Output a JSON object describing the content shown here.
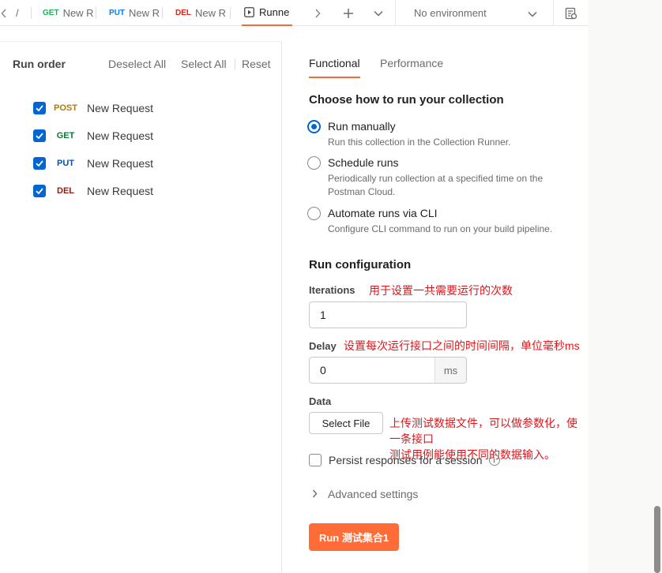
{
  "tabs": [
    {
      "method": "",
      "method_color": "#6b6b6b",
      "label": "/"
    },
    {
      "method": "GET",
      "method_color": "#0cbb52",
      "label": "New R"
    },
    {
      "method": "PUT",
      "method_color": "#097bed",
      "label": "New R"
    },
    {
      "method": "DEL",
      "method_color": "#eb2013",
      "label": "New R"
    },
    {
      "method": "",
      "method_color": "#212121",
      "label": "Runne"
    }
  ],
  "toolbar": {
    "back_icon": "chevron-left-icon",
    "forward_icon": "chevron-right-icon",
    "add_icon": "plus-icon",
    "menu_icon": "chevron-down-icon",
    "env_label": "No environment",
    "env_icon": "environment-quick-look-icon"
  },
  "left": {
    "run_order_label": "Run order",
    "deselect_all": "Deselect All",
    "select_all": "Select All",
    "reset": "Reset",
    "requests": [
      {
        "method": "POST",
        "color": "#ad7a03",
        "name": "New Request",
        "checked": true
      },
      {
        "method": "GET",
        "color": "#007f31",
        "name": "New Request",
        "checked": true
      },
      {
        "method": "PUT",
        "color": "#0053b8",
        "name": "New Request",
        "checked": true
      },
      {
        "method": "DEL",
        "color": "#8e1a10",
        "name": "New Request",
        "checked": true
      }
    ]
  },
  "right": {
    "tabs": [
      "Functional",
      "Performance"
    ],
    "active_tab": "Functional",
    "choose_title": "Choose how to run your collection",
    "options": [
      {
        "label": "Run manually",
        "desc": "Run this collection in the Collection Runner.",
        "selected": true
      },
      {
        "label": "Schedule runs",
        "desc": "Periodically run collection at a specified time on the Postman Cloud.",
        "selected": false
      },
      {
        "label": "Automate runs via CLI",
        "desc": "Configure CLI command to run on your build pipeline.",
        "selected": false
      }
    ],
    "config_title": "Run configuration",
    "iterations_label": "Iterations",
    "iterations_note": "用于设置一共需要运行的次数",
    "iterations_value": "1",
    "delay_label": "Delay",
    "delay_note": "设置每次运行接口之间的时间间隔，单位毫秒ms",
    "delay_value": "0",
    "delay_unit": "ms",
    "data_label": "Data",
    "select_file": "Select File",
    "data_note_line1": "上传测试数据文件，可以做参数化，使一条接口",
    "data_note_line2": "测试用例能使用不同的数据输入。",
    "persist_label": "Persist responses for a session",
    "info_glyph": "i",
    "advanced_label": "Advanced settings",
    "run_button": "Run 测试集合1"
  },
  "colors": {
    "accent": "#ff6c37",
    "checkbox": "#0265d2",
    "annotation": "#e0161b"
  }
}
